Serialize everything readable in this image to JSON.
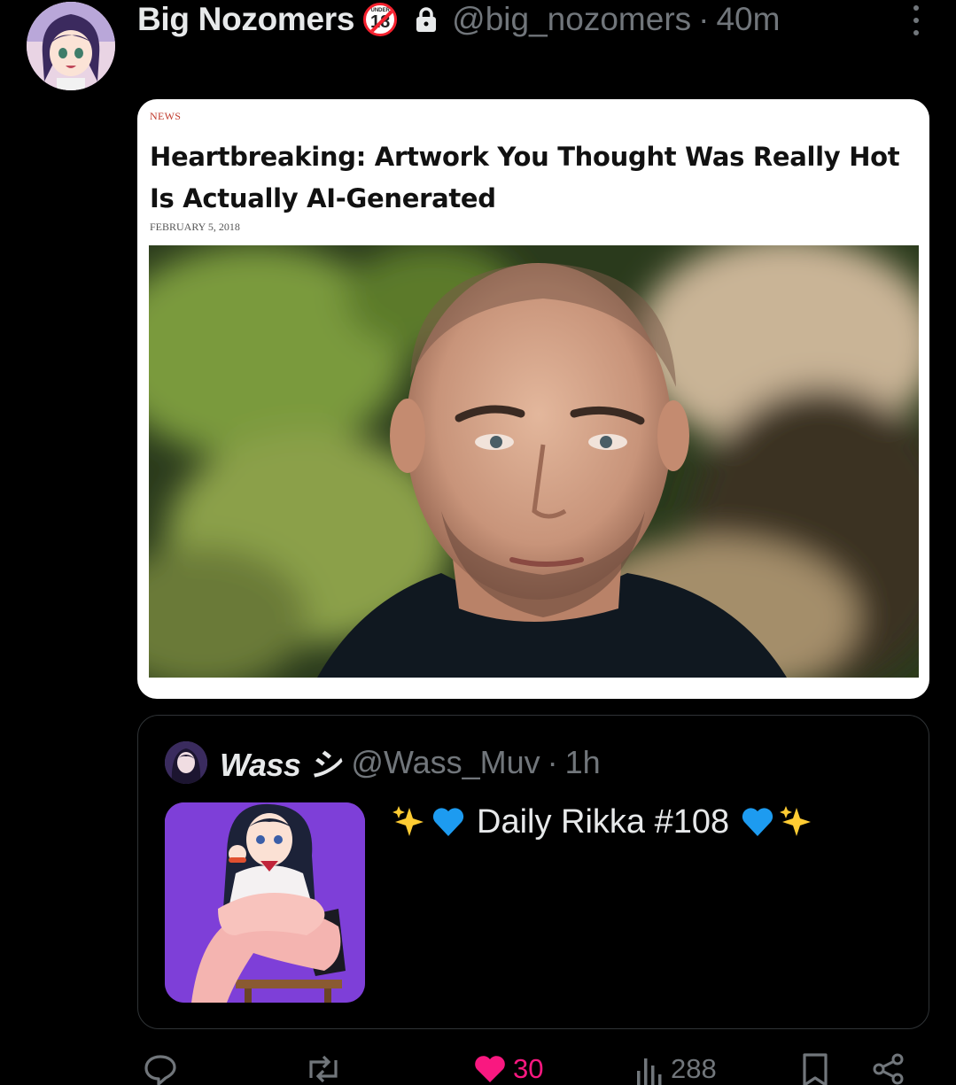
{
  "post": {
    "author": {
      "display_name": "Big Nozomers",
      "handle": "@big_nozomers",
      "separator": "·",
      "time": "40m",
      "badge_icon": "under-18-prohibited-icon",
      "badge_text": "UNDER",
      "badge_number": "18",
      "protected_icon": "lock-icon"
    }
  },
  "article": {
    "section": "NEWS",
    "title": "Heartbreaking: Artwork You Thought Was Really Hot Is Actually AI-Generated",
    "date": "FEBRUARY 5, 2018"
  },
  "quote": {
    "display_name": "Wass シ",
    "handle": "@Wass_Muv",
    "separator": "·",
    "time": "1h",
    "text": "Daily Rikka #108",
    "emojis_before": [
      "sparkles",
      "blue-heart"
    ],
    "emojis_after": [
      "blue-heart",
      "sparkles"
    ]
  },
  "actions": {
    "reply_icon": "reply-icon",
    "repost_icon": "repost-icon",
    "like_icon": "heart-filled-icon",
    "like_count": "30",
    "views_icon": "views-icon",
    "view_count": "288",
    "bookmark_icon": "bookmark-icon",
    "share_icon": "share-icon"
  },
  "colors": {
    "background": "#000000",
    "text_primary": "#e7e9ea",
    "text_secondary": "#71767b",
    "like_pink": "#f91880",
    "border": "#2f3336",
    "blue_heart": "#1d9bf0"
  }
}
